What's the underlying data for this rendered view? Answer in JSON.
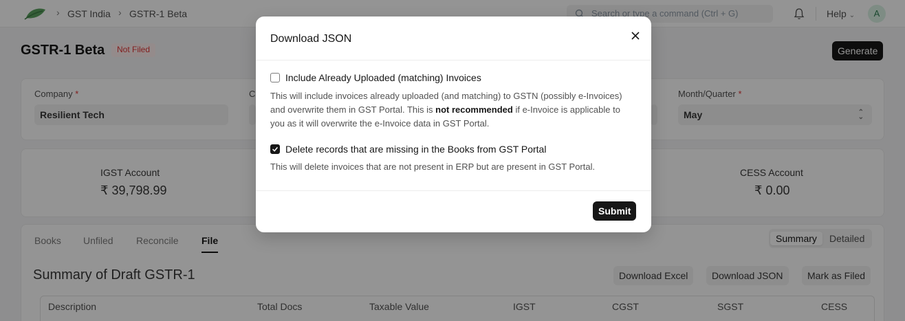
{
  "navbar": {
    "breadcrumbs": [
      "GST India",
      "GSTR-1 Beta"
    ],
    "search_placeholder": "Search or type a command (Ctrl + G)",
    "help_label": "Help",
    "avatar_initial": "A"
  },
  "page": {
    "title": "GSTR-1 Beta",
    "status": "Not Filed",
    "generate_label": "Generate"
  },
  "filters": {
    "company_label": "Company",
    "company_value": "Resilient Tech",
    "partial_label": "C",
    "period_label": "Month/Quarter",
    "period_value": "May",
    "required_mark": "*"
  },
  "accounts": {
    "igst_label": "IGST Account",
    "igst_value": "₹ 39,798.99",
    "cess_label": "CESS Account",
    "cess_value": "₹ 0.00"
  },
  "tabs": [
    "Books",
    "Unfiled",
    "Reconcile",
    "File"
  ],
  "active_tab": "File",
  "view_toggle": [
    "Summary",
    "Detailed"
  ],
  "summary": {
    "title": "Summary of Draft GSTR-1",
    "actions": [
      "Download Excel",
      "Download JSON",
      "Mark as Filed"
    ],
    "columns": [
      "Description",
      "Total Docs",
      "Taxable Value",
      "IGST",
      "CGST",
      "SGST",
      "CESS"
    ]
  },
  "modal": {
    "title": "Download JSON",
    "option1_label": "Include Already Uploaded (matching) Invoices",
    "option1_checked": false,
    "option1_desc_a": "This will include invoices already uploaded (and matching) to GSTN (possibly e-Invoices) and overwrite them in GST Portal. This is",
    "option1_desc_bold": "not recommended",
    "option1_desc_b": "if e-Invoice is applicable to you as it will overwrite the e-Invoice data in GST Portal.",
    "option2_label": "Delete records that are missing in the Books from GST Portal",
    "option2_checked": true,
    "option2_desc": "This will delete invoices that are not present in ERP but are present in GST Portal.",
    "submit_label": "Submit"
  },
  "colors": {
    "primary": "#171717",
    "overlay": "rgba(0,0,0,0.42)",
    "danger": "#e03636"
  }
}
